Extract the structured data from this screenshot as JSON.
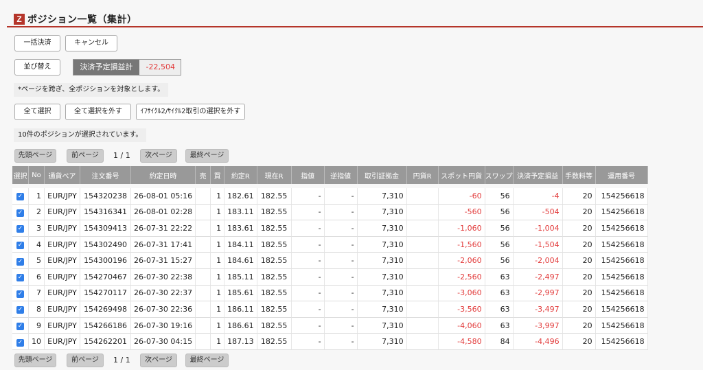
{
  "header": {
    "logo": "Z",
    "title": "ポジション一覧（集計）"
  },
  "actions": {
    "bulk_settle": "一括決済",
    "cancel": "キャンセル",
    "sort": "並び替え",
    "pl_label": "決済予定損益計",
    "pl_value": "-22,504"
  },
  "note": "*ページを跨ぎ、全ポジションを対象とします。",
  "selection": {
    "select_all": "全て選択",
    "deselect_all": "全て選択を外す",
    "deselect_cycle": "ｲﾌｻｲｸﾙ2/ｻｲｸﾙ2取引の選択を外す",
    "status": "10件のポジションが選択されています。"
  },
  "pager": {
    "first": "先頭ページ",
    "prev": "前ページ",
    "info": "1 / 1",
    "next": "次ページ",
    "last": "最終ページ"
  },
  "colors": {
    "accent": "#b5352a",
    "negative": "#e23b3b",
    "check": "#2f7ee8"
  },
  "table": {
    "headers": [
      "選択",
      "No",
      "通貨ペア",
      "注文番号",
      "約定日時",
      "売",
      "買",
      "約定R",
      "現在R",
      "指値",
      "逆指値",
      "取引証拠金",
      "円貨R",
      "スポット円貨",
      "スワップ",
      "決済予定損益",
      "手数料等",
      "運用番号"
    ],
    "rows": [
      [
        "1",
        "EUR/JPY",
        "154320238",
        "26-08-01 05:16",
        "",
        "1",
        "182.61",
        "182.55",
        "-",
        "-",
        "7,310",
        "",
        "-60",
        "56",
        "-4",
        "20",
        "154256618"
      ],
      [
        "2",
        "EUR/JPY",
        "154316341",
        "26-08-01 02:28",
        "",
        "1",
        "183.11",
        "182.55",
        "-",
        "-",
        "7,310",
        "",
        "-560",
        "56",
        "-504",
        "20",
        "154256618"
      ],
      [
        "3",
        "EUR/JPY",
        "154309413",
        "26-07-31 22:22",
        "",
        "1",
        "183.61",
        "182.55",
        "-",
        "-",
        "7,310",
        "",
        "-1,060",
        "56",
        "-1,004",
        "20",
        "154256618"
      ],
      [
        "4",
        "EUR/JPY",
        "154302490",
        "26-07-31 17:41",
        "",
        "1",
        "184.11",
        "182.55",
        "-",
        "-",
        "7,310",
        "",
        "-1,560",
        "56",
        "-1,504",
        "20",
        "154256618"
      ],
      [
        "5",
        "EUR/JPY",
        "154300196",
        "26-07-31 15:27",
        "",
        "1",
        "184.61",
        "182.55",
        "-",
        "-",
        "7,310",
        "",
        "-2,060",
        "56",
        "-2,004",
        "20",
        "154256618"
      ],
      [
        "6",
        "EUR/JPY",
        "154270467",
        "26-07-30 22:38",
        "",
        "1",
        "185.11",
        "182.55",
        "-",
        "-",
        "7,310",
        "",
        "-2,560",
        "63",
        "-2,497",
        "20",
        "154256618"
      ],
      [
        "7",
        "EUR/JPY",
        "154270117",
        "26-07-30 22:37",
        "",
        "1",
        "185.61",
        "182.55",
        "-",
        "-",
        "7,310",
        "",
        "-3,060",
        "63",
        "-2,997",
        "20",
        "154256618"
      ],
      [
        "8",
        "EUR/JPY",
        "154269498",
        "26-07-30 22:36",
        "",
        "1",
        "186.11",
        "182.55",
        "-",
        "-",
        "7,310",
        "",
        "-3,560",
        "63",
        "-3,497",
        "20",
        "154256618"
      ],
      [
        "9",
        "EUR/JPY",
        "154266186",
        "26-07-30 19:16",
        "",
        "1",
        "186.61",
        "182.55",
        "-",
        "-",
        "7,310",
        "",
        "-4,060",
        "63",
        "-3,997",
        "20",
        "154256618"
      ],
      [
        "10",
        "EUR/JPY",
        "154262201",
        "26-07-30 04:15",
        "",
        "1",
        "187.13",
        "182.55",
        "-",
        "-",
        "7,310",
        "",
        "-4,580",
        "84",
        "-4,496",
        "20",
        "154256618"
      ]
    ]
  }
}
